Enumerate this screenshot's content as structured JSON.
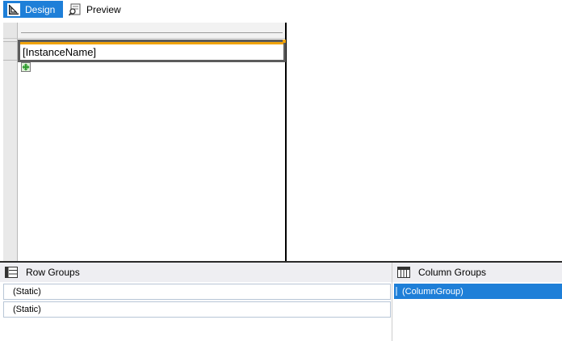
{
  "toolbar": {
    "design_label": "Design",
    "preview_label": "Preview"
  },
  "report": {
    "cell_text": "[InstanceName]"
  },
  "row_groups": {
    "title": "Row Groups",
    "items": [
      "(Static)",
      "(Static)"
    ]
  },
  "column_groups": {
    "title": "Column Groups",
    "items": [
      "(ColumnGroup)"
    ]
  },
  "colors": {
    "accent": "#1e7fd8",
    "selection_outline": "#f0a30a",
    "header_bg": "#eeeef2"
  },
  "icons": {
    "design": "design-icon",
    "preview": "preview-icon",
    "row_groups": "row-groups-icon",
    "column_groups": "column-groups-icon",
    "move_handle": "move-handle-icon"
  }
}
